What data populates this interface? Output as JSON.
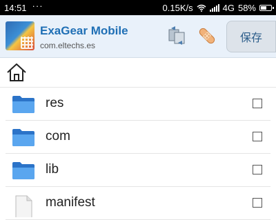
{
  "status_bar": {
    "time": "14:51",
    "dots": "···",
    "network_speed": "0.15K/s",
    "network_type": "4G",
    "battery_percent": "58%",
    "battery_level": 0.58
  },
  "header": {
    "app_name": "ExaGear Mobile",
    "package": "com.eltechs.es",
    "save_label": "保存"
  },
  "icons": {
    "home": "home-icon",
    "folder": "folder-icon",
    "file": "file-icon",
    "swap": "swap-icon",
    "tool": "bandage-icon"
  },
  "colors": {
    "header_bg": "#e9f1fa",
    "title": "#1f6fb5",
    "folder": "#3d8fe0"
  },
  "files": [
    {
      "name": "res",
      "type": "folder",
      "checked": false
    },
    {
      "name": "com",
      "type": "folder",
      "checked": false
    },
    {
      "name": "lib",
      "type": "folder",
      "checked": false
    },
    {
      "name": "manifest",
      "type": "file",
      "checked": false
    }
  ]
}
